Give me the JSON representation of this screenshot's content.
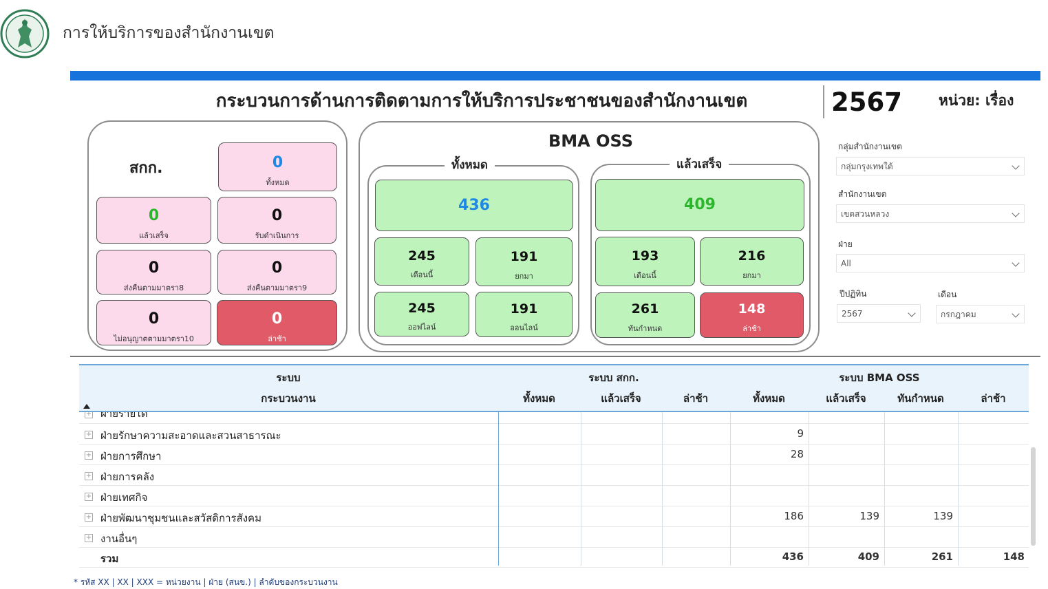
{
  "header": {
    "app_title": "การให้บริการของสำนักงานเขต",
    "main_title": "กระบวนการด้านการติดตามการให้บริการประชาชนของสำนักงานเขต",
    "year": "2567",
    "unit": "หน่วย: เรื่อง"
  },
  "colors": {
    "accent": "#1673dc",
    "pink": "#fdd9ec",
    "green": "#bef3bc",
    "red": "#e05a68",
    "blue_value": "#1e88e5",
    "green_value": "#2db52d"
  },
  "skk": {
    "title": "สกก.",
    "cards": [
      {
        "value": "0",
        "label": "ทั้งหมด"
      },
      {
        "value": "0",
        "label": "แล้วเสร็จ"
      },
      {
        "value": "0",
        "label": "รับดำเนินการ"
      },
      {
        "value": "0",
        "label": "ส่งคืนตามมาตรา8"
      },
      {
        "value": "0",
        "label": "ส่งคืนตามมาตรา9"
      },
      {
        "value": "0",
        "label": "ไม่อนุญาตตามมาตรา10"
      },
      {
        "value": "0",
        "label": "ล่าช้า"
      }
    ]
  },
  "oss": {
    "title": "BMA OSS",
    "total": {
      "title": "ทั้งหมด",
      "main": "436",
      "cards": [
        {
          "value": "245",
          "label": "เดือนนี้"
        },
        {
          "value": "191",
          "label": "ยกมา"
        },
        {
          "value": "245",
          "label": "ออฟไลน์"
        },
        {
          "value": "191",
          "label": "ออนไลน์"
        }
      ]
    },
    "done": {
      "title": "แล้วเสร็จ",
      "main": "409",
      "cards": [
        {
          "value": "193",
          "label": "เดือนนี้"
        },
        {
          "value": "216",
          "label": "ยกมา"
        },
        {
          "value": "261",
          "label": "ทันกำหนด"
        },
        {
          "value": "148",
          "label": "ล่าช้า"
        }
      ]
    }
  },
  "filters": {
    "group": {
      "label": "กลุ่มสำนักงานเขต",
      "value": "กลุ่มกรุงเทพใต้"
    },
    "district": {
      "label": "สำนักงานเขต",
      "value": "เขตสวนหลวง"
    },
    "division": {
      "label": "ฝ่าย",
      "value": "All"
    },
    "year": {
      "label": "ปีปฏิทิน",
      "value": "2567"
    },
    "month": {
      "label": "เดือน",
      "value": "กรกฎาคม"
    }
  },
  "table": {
    "group_headers": {
      "system": "ระบบ",
      "skk": "ระบบ สกก.",
      "oss": "ระบบ BMA OSS"
    },
    "columns": {
      "process": "กระบวนงาน",
      "skk_total": "ทั้งหมด",
      "skk_done": "แล้วเสร็จ",
      "skk_late": "ล่าช้า",
      "oss_total": "ทั้งหมด",
      "oss_done": "แล้วเสร็จ",
      "oss_ontime": "ทันกำหนด",
      "oss_late": "ล่าช้า"
    },
    "sort_icon": "sort-up-icon",
    "rows": [
      {
        "name": "ฝ่ายรายได้",
        "v": [
          "",
          "",
          "",
          "",
          "",
          "",
          ""
        ]
      },
      {
        "name": "ฝ่ายรักษาความสะอาดและสวนสาธารณะ",
        "v": [
          "",
          "",
          "",
          "9",
          "",
          "",
          ""
        ]
      },
      {
        "name": "ฝ่ายการศึกษา",
        "v": [
          "",
          "",
          "",
          "28",
          "",
          "",
          ""
        ]
      },
      {
        "name": "ฝ่ายการคลัง",
        "v": [
          "",
          "",
          "",
          "",
          "",
          "",
          ""
        ]
      },
      {
        "name": "ฝ่ายเทศกิจ",
        "v": [
          "",
          "",
          "",
          "",
          "",
          "",
          ""
        ]
      },
      {
        "name": "ฝ่ายพัฒนาชุมชนและสวัสดิการสังคม",
        "v": [
          "",
          "",
          "",
          "186",
          "139",
          "139",
          ""
        ]
      },
      {
        "name": "งานอื่นๆ",
        "v": [
          "",
          "",
          "",
          "",
          "",
          "",
          ""
        ]
      }
    ],
    "total": {
      "name": "รวม",
      "v": [
        "",
        "",
        "",
        "436",
        "409",
        "261",
        "148"
      ]
    }
  },
  "footnote": "* รหัส XX | XX | XXX = หน่วยงาน | ฝ่าย (สนข.) | ลำดับของกระบวนงาน"
}
